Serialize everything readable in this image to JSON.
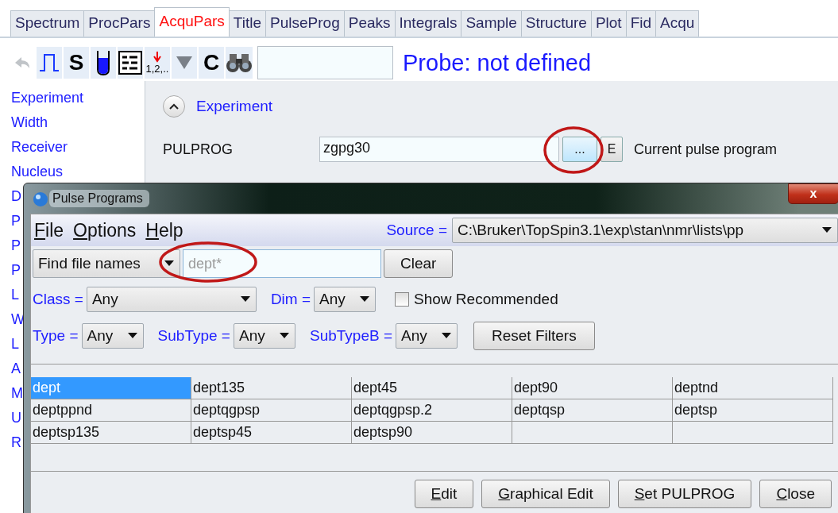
{
  "tabs": [
    {
      "label": "Spectrum",
      "selected": false
    },
    {
      "label": "ProcPars",
      "selected": false
    },
    {
      "label": "AcquPars",
      "selected": true
    },
    {
      "label": "Title",
      "selected": false
    },
    {
      "label": "PulseProg",
      "selected": false
    },
    {
      "label": "Peaks",
      "selected": false
    },
    {
      "label": "Integrals",
      "selected": false
    },
    {
      "label": "Sample",
      "selected": false
    },
    {
      "label": "Structure",
      "selected": false
    },
    {
      "label": "Plot",
      "selected": false
    },
    {
      "label": "Fid",
      "selected": false
    },
    {
      "label": "Acqu",
      "selected": false
    }
  ],
  "toolbar": {
    "items": [
      {
        "kind": "undo",
        "disabled": true
      },
      {
        "kind": "pulse",
        "disabled": false
      },
      {
        "kind": "letter",
        "label": "S",
        "disabled": false
      },
      {
        "kind": "tube",
        "disabled": false
      },
      {
        "kind": "table",
        "disabled": false
      },
      {
        "kind": "numbering",
        "label": "1,2,..",
        "disabled": false
      },
      {
        "kind": "triangle",
        "disabled": false
      },
      {
        "kind": "letter",
        "label": "C",
        "disabled": false
      },
      {
        "kind": "binoculars",
        "disabled": false
      }
    ],
    "probe": "Probe: not defined"
  },
  "sidebar": {
    "items": [
      "Experiment",
      "Width",
      "Receiver",
      "Nucleus",
      "D",
      "P",
      "P",
      "P",
      "L",
      "W",
      "L",
      "A",
      "M",
      "U",
      "R"
    ]
  },
  "section": {
    "title": "Experiment",
    "expanded": true
  },
  "parameters": [
    {
      "name": "PULPROG",
      "value": "zgpg30",
      "kind": "text",
      "browse": "...",
      "circled": true,
      "edit": "E",
      "description": "Current pulse program"
    }
  ],
  "dialog": {
    "title": "Pulse Programs",
    "close": "x",
    "menu": [
      {
        "label": "File"
      },
      {
        "label": "Options"
      },
      {
        "label": "Help"
      }
    ],
    "source": {
      "label": "Source =",
      "value": "C:\\Bruker\\TopSpin3.1\\exp\\stan\\nmr\\lists\\pp"
    },
    "search": {
      "mode": "Find file names",
      "placeholder": "dept*",
      "circled": true,
      "clear": "Clear"
    },
    "filters": [
      [
        {
          "label": "Class =",
          "value": "Any",
          "kind": "wide"
        },
        {
          "label": "Dim =",
          "value": "Any",
          "kind": "narrow"
        },
        {
          "kind": "checkbox",
          "label": "Show Recommended",
          "checked": false
        }
      ],
      [
        {
          "label": "Type =",
          "value": "Any",
          "kind": "narrow"
        },
        {
          "label": "SubType =",
          "value": "Any",
          "kind": "narrow"
        },
        {
          "label": "SubTypeB =",
          "value": "Any",
          "kind": "narrow"
        },
        {
          "kind": "button",
          "label": "Reset Filters"
        }
      ]
    ],
    "table": {
      "rows": [
        [
          {
            "text": "dept",
            "selected": true
          },
          {
            "text": "dept135",
            "selected": false
          },
          {
            "text": "dept45",
            "selected": false
          },
          {
            "text": "dept90",
            "selected": false
          },
          {
            "text": "deptnd",
            "selected": false
          }
        ],
        [
          {
            "text": "deptppnd",
            "selected": false
          },
          {
            "text": "deptqgpsp",
            "selected": false
          },
          {
            "text": "deptqgpsp.2",
            "selected": false
          },
          {
            "text": "deptqsp",
            "selected": false
          },
          {
            "text": "deptsp",
            "selected": false
          }
        ],
        [
          {
            "text": "deptsp135",
            "selected": false
          },
          {
            "text": "deptsp45",
            "selected": false
          },
          {
            "text": "deptsp90",
            "selected": false
          },
          {
            "text": null,
            "selected": false
          },
          {
            "text": null,
            "selected": false
          }
        ]
      ]
    },
    "buttons": [
      {
        "label": "Edit",
        "mnemonic": true
      },
      {
        "label": "Graphical Edit",
        "mnemonic": true
      },
      {
        "label": "Set PULPROG",
        "mnemonic": true
      },
      {
        "label": "Close",
        "mnemonic": true
      }
    ]
  }
}
